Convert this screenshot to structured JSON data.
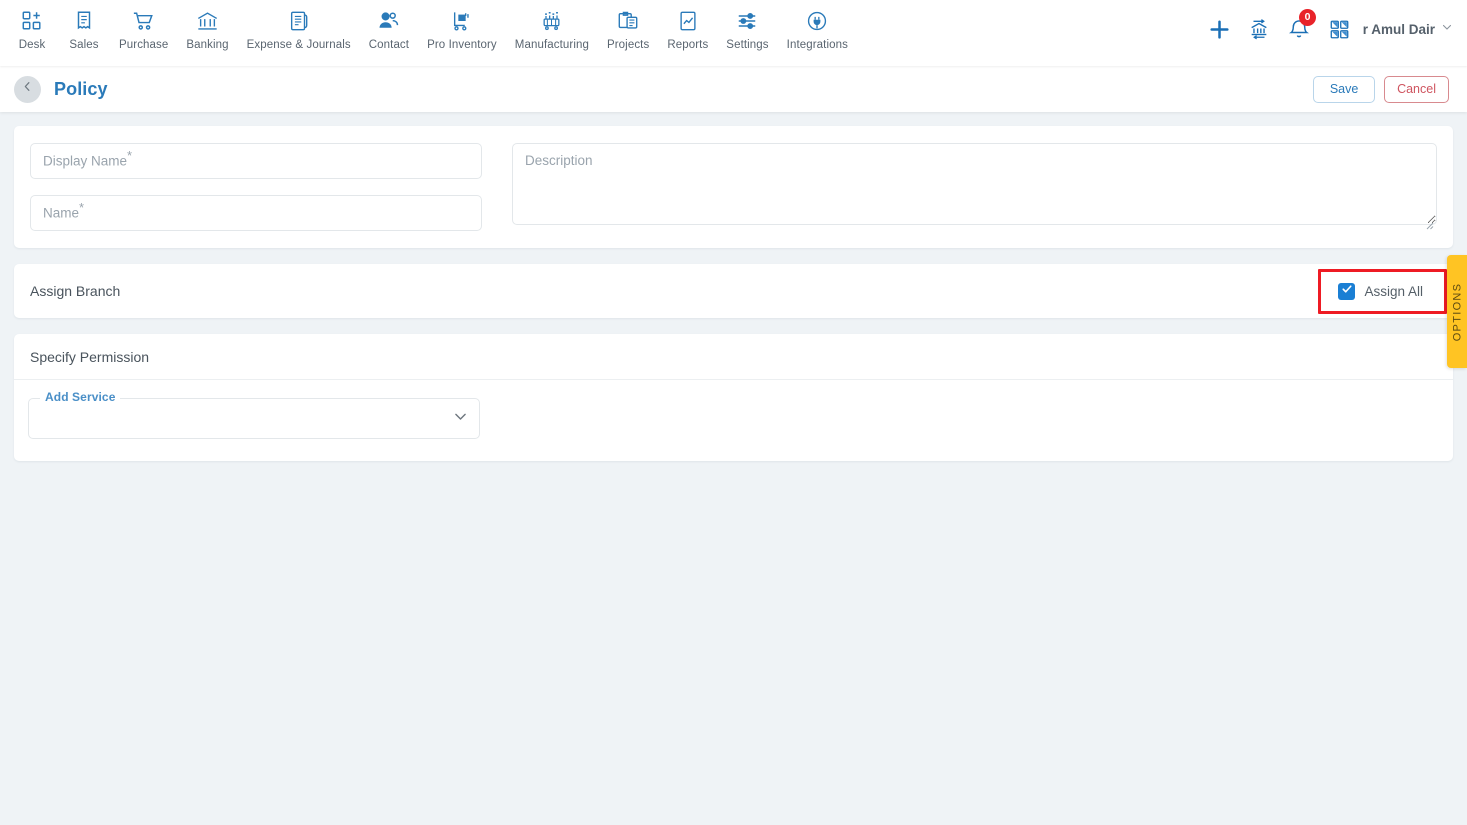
{
  "topnav": {
    "modules": [
      {
        "label": "Desk",
        "icon": "desk-icon"
      },
      {
        "label": "Sales",
        "icon": "sales-icon"
      },
      {
        "label": "Purchase",
        "icon": "purchase-icon"
      },
      {
        "label": "Banking",
        "icon": "banking-icon"
      },
      {
        "label": "Expense & Journals",
        "icon": "expense-journals-icon"
      },
      {
        "label": "Contact",
        "icon": "contact-icon"
      },
      {
        "label": "Pro Inventory",
        "icon": "pro-inventory-icon"
      },
      {
        "label": "Manufacturing",
        "icon": "manufacturing-icon"
      },
      {
        "label": "Projects",
        "icon": "projects-icon"
      },
      {
        "label": "Reports",
        "icon": "reports-icon"
      },
      {
        "label": "Settings",
        "icon": "settings-icon"
      },
      {
        "label": "Integrations",
        "icon": "integrations-icon"
      }
    ],
    "actions": {
      "add": "plus-icon",
      "bank": "bank-transfer-icon",
      "notifications": "bell-icon",
      "notification_count": "0",
      "apps": "apps-grid-icon"
    },
    "organization": {
      "name": "nar Amul Dair",
      "caret": "chevron-down-icon"
    }
  },
  "page_header": {
    "back": "chevron-left-icon",
    "title": "Policy",
    "save_label": "Save",
    "cancel_label": "Cancel"
  },
  "form": {
    "display_name": {
      "placeholder": "Display Name",
      "required_mark": "*",
      "value": ""
    },
    "name": {
      "placeholder": "Name",
      "required_mark": "*",
      "value": ""
    },
    "description": {
      "placeholder": "Description",
      "value": ""
    }
  },
  "assign_branch": {
    "section_label": "Assign Branch",
    "assign_all_label": "Assign All",
    "assign_all_checked": true,
    "checkmark": "check-icon",
    "highlight_color": "#ee1b24"
  },
  "specify_permission": {
    "section_label": "Specify Permission",
    "add_service": {
      "legend": "Add Service",
      "value": "",
      "caret": "chevron-down-icon"
    }
  },
  "options_tab": {
    "label": "OPTIONS",
    "color": "#ffc423"
  },
  "colors": {
    "accent_blue": "#2a7ab9",
    "danger_red": "#cf5560",
    "checkbox_blue": "#1a7fd4",
    "page_bg": "#eff3f6",
    "card_bg": "#ffffff"
  }
}
